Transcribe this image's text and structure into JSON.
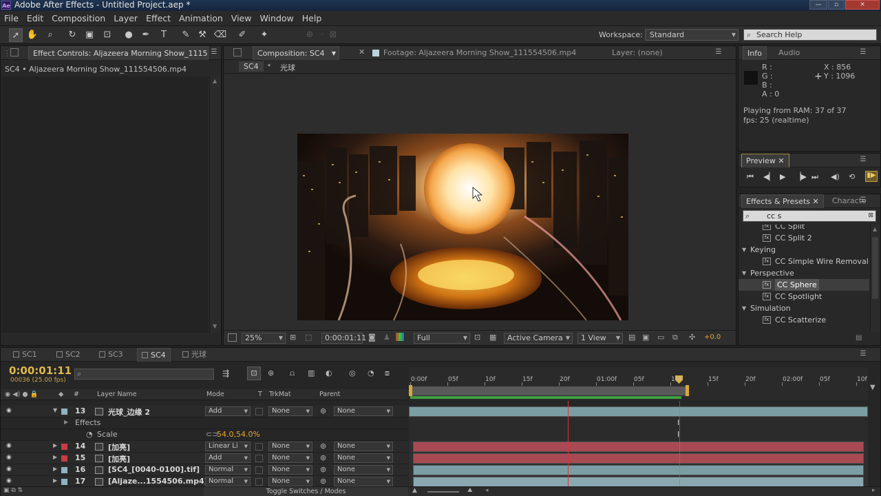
{
  "window": {
    "title": "Adobe After Effects - Untitled Project.aep *",
    "logo": "Ae"
  },
  "menu": [
    "File",
    "Edit",
    "Composition",
    "Layer",
    "Effect",
    "Animation",
    "View",
    "Window",
    "Help"
  ],
  "workspace": {
    "label": "Workspace:",
    "value": "Standard"
  },
  "search_help": {
    "placeholder": "Search Help"
  },
  "effect_controls": {
    "tab": "Effect Controls: Aljazeera Morning Show_1115",
    "layer": "SC4 • Aljazeera Morning Show_111554506.mp4"
  },
  "viewer": {
    "tab_comp": "Composition: SC4",
    "tab_footage": "Footage: Aljazeera Morning Show_111554506.mp4",
    "tab_layer": "Layer: (none)",
    "breadcrumb_comp": "SC4",
    "breadcrumb_child": "光球",
    "zoom": "25%",
    "timecode": "0:00:01:11",
    "resolution": "Full",
    "camera": "Active Camera",
    "views": "1 View",
    "exposure": "+0.0"
  },
  "info": {
    "tab_info": "Info",
    "tab_audio": "Audio",
    "r": "R :",
    "g": "G :",
    "b": "B :",
    "a": "A : 0",
    "x": "X : 856",
    "y": "Y : 1096",
    "playing": "Playing from RAM: 37 of 37",
    "fps": "fps: 25 (realtime)"
  },
  "preview": {
    "tab": "Preview"
  },
  "effects_presets": {
    "tab": "Effects & Presets",
    "tab2": "Characte",
    "search": "cc s",
    "items": [
      {
        "type": "item",
        "label": "CC Split"
      },
      {
        "type": "item",
        "label": "CC Split 2"
      },
      {
        "type": "cat",
        "label": "Keying"
      },
      {
        "type": "item",
        "label": "CC Simple Wire Removal"
      },
      {
        "type": "cat",
        "label": "Perspective"
      },
      {
        "type": "item",
        "label": "CC Sphere",
        "selected": true
      },
      {
        "type": "item",
        "label": "CC Spotlight"
      },
      {
        "type": "cat",
        "label": "Simulation"
      },
      {
        "type": "item",
        "label": "CC Scatterize"
      }
    ]
  },
  "timeline": {
    "tabs": [
      "SC1",
      "SC2",
      "SC3",
      "SC4",
      "光球"
    ],
    "timecode": "0:00:01:11",
    "frames": "00036 (25.00 fps)",
    "search_placeholder": "",
    "col_layer_name": "Layer Name",
    "col_mode": "Mode",
    "col_t": "T",
    "col_trkmat": "TrkMat",
    "col_parent": "Parent",
    "col_num": "#",
    "ruler": [
      "0:00f",
      "05f",
      "10f",
      "15f",
      "20f",
      "01:00f",
      "05f",
      "10f",
      "15f",
      "20f",
      "02:00f",
      "05f",
      "10f"
    ],
    "layers": [
      {
        "num": "13",
        "name": "光球_边缘 2",
        "mode": "Add",
        "trkmat": "None",
        "parent": "None",
        "color": "#8fb3c0",
        "track": "#7a9ea4"
      },
      {
        "num": "14",
        "name": "[加亮]",
        "mode": "Linear Li",
        "trkmat": "None",
        "parent": "None",
        "color": "#c83c44",
        "track": "#a94954"
      },
      {
        "num": "15",
        "name": "[加亮]",
        "mode": "Add",
        "trkmat": "None",
        "parent": "None",
        "color": "#c83c44",
        "track": "#a94954"
      },
      {
        "num": "16",
        "name": "[SC4_[0040-0100].tif]",
        "mode": "Normal",
        "trkmat": "None",
        "parent": "None",
        "color": "#8fb3c0",
        "track": "#7a9ea4"
      },
      {
        "num": "17",
        "name": "[Aljaze...1554506.mp4]",
        "mode": "Normal",
        "trkmat": "None",
        "parent": "None",
        "color": "#8fb3c0",
        "track": "#8aa8b0"
      }
    ],
    "effects_label": "Effects",
    "scale_label": "Scale",
    "scale_value": "54.0,54.0%",
    "toggle": "Toggle Switches / Modes"
  },
  "colors": {
    "accent": "#e9a52a",
    "timecode": "#e0b84a",
    "bg": "#282828"
  }
}
